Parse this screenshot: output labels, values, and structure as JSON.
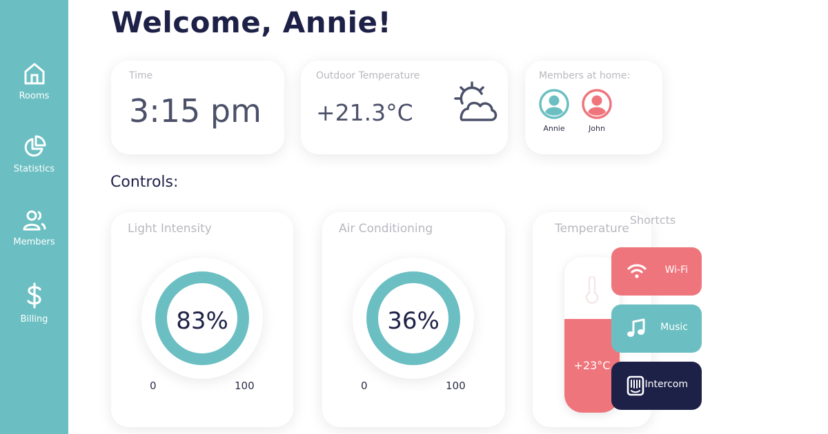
{
  "sidebar": {
    "items": [
      {
        "label": "Rooms",
        "icon": "home-icon"
      },
      {
        "label": "Statistics",
        "icon": "pie-chart-icon"
      },
      {
        "label": "Members",
        "icon": "users-icon"
      },
      {
        "label": "Billing",
        "icon": "dollar-icon"
      }
    ]
  },
  "header": {
    "welcome": "Welcome, Annie!"
  },
  "cards": {
    "time": {
      "label": "Time",
      "value": "3:15 pm"
    },
    "outdoor": {
      "label": "Outdoor Temperature",
      "value": "+21.3°C",
      "icon": "partly-cloudy-icon"
    },
    "members": {
      "label": "Members at home:",
      "people": [
        {
          "name": "Annie",
          "color": "#6bbfc2"
        },
        {
          "name": "John",
          "color": "#ef757c"
        }
      ]
    }
  },
  "controls": {
    "heading": "Controls:",
    "light": {
      "label": "Light Intensity",
      "value": "83%",
      "min": "0",
      "max": "100"
    },
    "ac": {
      "label": "Air Conditioning",
      "value": "36%",
      "min": "0",
      "max": "100"
    },
    "temperature": {
      "label": "Temperature",
      "value": "+23°C",
      "level": 0.6
    }
  },
  "shortcuts": {
    "title": "Shortcts",
    "items": [
      {
        "label": "Wi-Fi",
        "icon": "wifi-icon",
        "color": "#ef757c"
      },
      {
        "label": "Music",
        "icon": "music-note-icon",
        "color": "#6bbfc2"
      },
      {
        "label": "Intercom",
        "icon": "intercom-icon",
        "color": "#1e2147"
      }
    ]
  },
  "colors": {
    "accent": "#6bbfc2",
    "warm": "#ef757c",
    "dark": "#1e2147"
  }
}
